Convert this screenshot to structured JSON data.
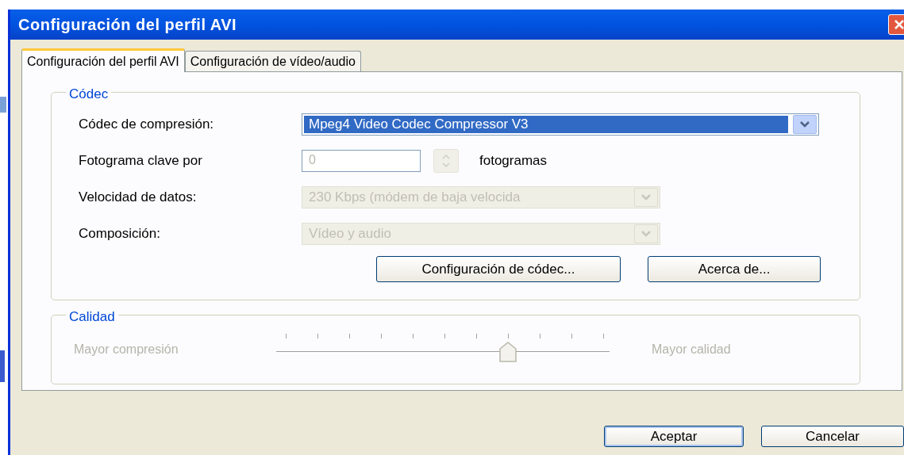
{
  "window": {
    "title": "Configuración del perfil AVI"
  },
  "tabs": [
    {
      "label": "Configuración del perfil AVI",
      "selected": true
    },
    {
      "label": "Configuración de vídeo/audio",
      "selected": false
    }
  ],
  "codec_group": {
    "title": "Códec",
    "rows": [
      {
        "kind": "combo",
        "label": "Códec de compresión:",
        "value": "Mpeg4 Video Codec Compressor V3",
        "disabled": false
      },
      {
        "kind": "spin",
        "label": "Fotograma clave por",
        "value": "0",
        "suffix": "fotogramas",
        "disabled": true
      },
      {
        "kind": "combo",
        "label": "Velocidad de datos:",
        "value": "230 Kbps (módem de baja velocida",
        "disabled": true
      },
      {
        "kind": "combo",
        "label": "Composición:",
        "value": "Vídeo y audio",
        "disabled": true
      }
    ],
    "buttons": [
      "Configuración de códec...",
      "Acerca de..."
    ]
  },
  "quality_group": {
    "title": "Calidad",
    "left_label": "Mayor compresión",
    "right_label": "Mayor calidad",
    "level": 0.7,
    "disabled": true
  },
  "buttons": [
    "Aceptar",
    "Cancelar"
  ]
}
